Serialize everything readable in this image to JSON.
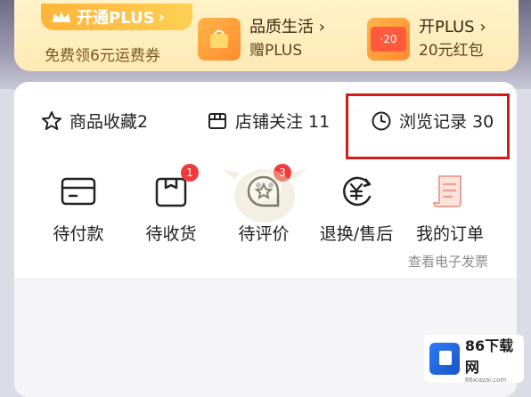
{
  "plus": {
    "open_label": "开通PLUS",
    "open_arrow": "›",
    "sub": "免费领6元运费券",
    "perk1_title": "品质生活",
    "perk1_arrow": "›",
    "perk1_sub": "赠PLUS",
    "perk2_title": "开PLUS",
    "perk2_arrow": "›",
    "perk2_sub": "20元红包",
    "coupon_text": "·20"
  },
  "stats": {
    "favorites": "商品收藏2",
    "follows": "店铺关注 11",
    "history": "浏览记录 30"
  },
  "orders": [
    {
      "label": "待付款"
    },
    {
      "label": "待收货",
      "badge": "1"
    },
    {
      "label": "待评价",
      "badge": "3"
    },
    {
      "label": "退换/售后"
    },
    {
      "label": "我的订单"
    }
  ],
  "invoice_link": "查看电子发票",
  "logo": {
    "name": "86下载网",
    "domain": "86xiazai.com"
  },
  "colors": {
    "accent": "#ffb43a",
    "highlight": "#d41a1a",
    "badge": "#f23a3a"
  },
  "icons": [
    "crown-icon",
    "star-icon",
    "store-icon",
    "clock-icon",
    "wallet-icon",
    "package-icon",
    "review-icon",
    "refund-icon",
    "order-list-icon"
  ]
}
